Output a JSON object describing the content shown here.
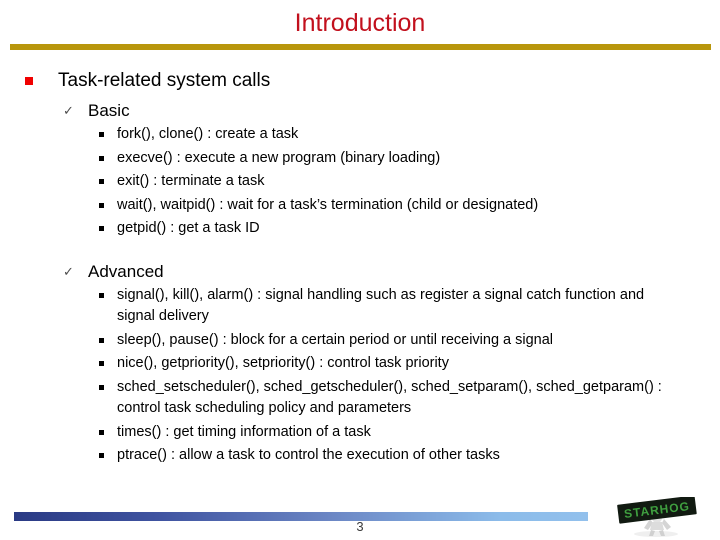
{
  "slide": {
    "title": "Introduction",
    "page_number": "3",
    "title_color": "#c2101d",
    "rule_color": "#b8960c",
    "bullet_color": "#f00000",
    "footer_bar_from": "#2a3a84",
    "footer_bar_to": "#8cbcea"
  },
  "outline": {
    "heading": "Task-related system calls",
    "sections": [
      {
        "label": "Basic",
        "items": [
          "fork(), clone() : create a task",
          "execve() : execute a new program (binary loading)",
          "exit() : terminate a task",
          "wait(), waitpid() : wait for a task’s termination (child or designated)",
          "getpid() : get a task ID"
        ]
      },
      {
        "label": "Advanced",
        "items": [
          "signal(), kill(), alarm() : signal handling such as register a signal catch function and signal delivery",
          "sleep(), pause() : block for a certain period or until receiving a signal",
          "nice(), getpriority(), setpriority() : control task priority",
          "sched_setscheduler(), sched_getscheduler(), sched_setparam(), sched_getparam() : control task scheduling policy and parameters",
          "times() : get timing information of a task",
          "ptrace() : allow a task to control the execution of other tasks"
        ]
      }
    ]
  },
  "logo": {
    "text": "STARHOG",
    "sign_color": "#101a10",
    "text_color": "#3f9f3f",
    "figure_color": "#d8d8d8"
  }
}
